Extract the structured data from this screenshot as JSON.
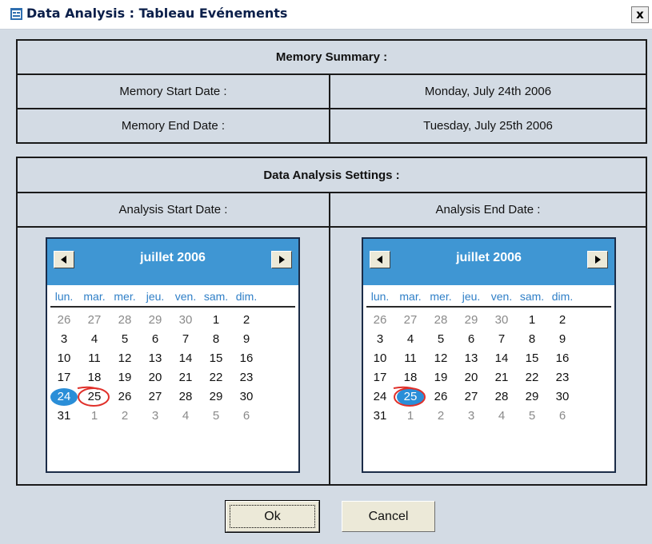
{
  "window": {
    "title": "Data Analysis : Tableau Evénements",
    "close_label": "x"
  },
  "memory_summary": {
    "header": "Memory Summary :",
    "start_label": "Memory Start Date :",
    "start_value": "Monday, July 24th 2006",
    "end_label": "Memory End Date :",
    "end_value": "Tuesday, July 25th 2006"
  },
  "analysis_settings": {
    "header": "Data Analysis Settings :",
    "start_label": "Analysis Start Date :",
    "end_label": "Analysis End Date :"
  },
  "calendars": [
    {
      "month_label": "juillet 2006",
      "weekdays": [
        "lun.",
        "mar.",
        "mer.",
        "jeu.",
        "ven.",
        "sam.",
        "dim."
      ],
      "weeks": [
        [
          "26",
          "27",
          "28",
          "29",
          "30",
          "1",
          "2"
        ],
        [
          "3",
          "4",
          "5",
          "6",
          "7",
          "8",
          "9"
        ],
        [
          "10",
          "11",
          "12",
          "13",
          "14",
          "15",
          "16"
        ],
        [
          "17",
          "18",
          "19",
          "20",
          "21",
          "22",
          "23"
        ],
        [
          "24",
          "25",
          "26",
          "27",
          "28",
          "29",
          "30"
        ],
        [
          "31",
          "1",
          "2",
          "3",
          "4",
          "5",
          "6"
        ]
      ],
      "selected_day": "24",
      "circled_day": "25"
    },
    {
      "month_label": "juillet 2006",
      "weekdays": [
        "lun.",
        "mar.",
        "mer.",
        "jeu.",
        "ven.",
        "sam.",
        "dim."
      ],
      "weeks": [
        [
          "26",
          "27",
          "28",
          "29",
          "30",
          "1",
          "2"
        ],
        [
          "3",
          "4",
          "5",
          "6",
          "7",
          "8",
          "9"
        ],
        [
          "10",
          "11",
          "12",
          "13",
          "14",
          "15",
          "16"
        ],
        [
          "17",
          "18",
          "19",
          "20",
          "21",
          "22",
          "23"
        ],
        [
          "24",
          "25",
          "26",
          "27",
          "28",
          "29",
          "30"
        ],
        [
          "31",
          "1",
          "2",
          "3",
          "4",
          "5",
          "6"
        ]
      ],
      "selected_day": "25",
      "circled_day": "25"
    }
  ],
  "buttons": {
    "ok_label": "Ok",
    "cancel_label": "Cancel"
  },
  "colors": {
    "dialog_bg": "#d3dbe4",
    "calendar_header": "#3f96d3",
    "selected_day": "#2a8ed8",
    "annotation_circle": "#e0302a",
    "weekday_text": "#2f7fc7"
  }
}
